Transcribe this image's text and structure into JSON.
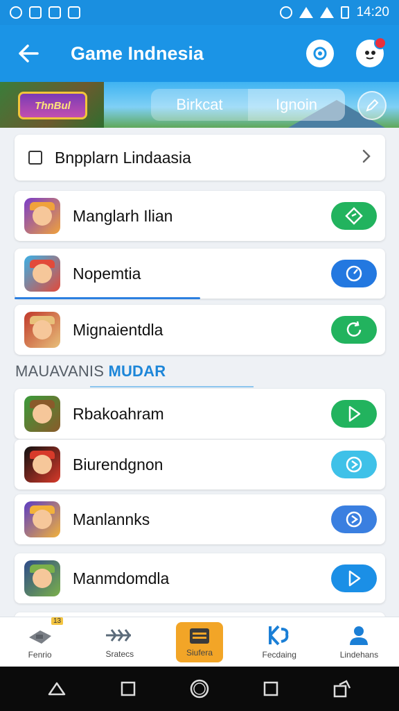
{
  "status_bar": {
    "time": "14:20"
  },
  "app_bar": {
    "title": "Game Indnesia"
  },
  "banner": {
    "logo_text": "ThnBul",
    "tabs": [
      {
        "label": "Birkcat",
        "active": false
      },
      {
        "label": "Ignoin",
        "active": true
      }
    ]
  },
  "select_row": {
    "label": "Bnpplarn Lindaasia"
  },
  "games_top": [
    {
      "name": "Manglarh Ilian",
      "button_color": "#22b35e",
      "icon_colors": [
        "#7a3cc9",
        "#f0a23b"
      ]
    },
    {
      "name": "Nopemtia",
      "button_color": "#2378e0",
      "icon_colors": [
        "#3bb0e6",
        "#e24a3a"
      ],
      "progress": 0.5
    },
    {
      "name": "Mignaientdla",
      "button_color": "#22b35e",
      "icon_colors": [
        "#c0392b",
        "#e8c07a"
      ]
    }
  ],
  "section": {
    "label_plain": "MAUAVANIS",
    "label_accent": "MUDAR"
  },
  "games_bottom": [
    {
      "name": "Rbakoahram",
      "button_color": "#22b35e",
      "icon_colors": [
        "#3a9b3a",
        "#8a5a2a"
      ]
    },
    {
      "name": "Biurendgnon",
      "button_color": "#3fc1e8",
      "icon_colors": [
        "#111111",
        "#d83a2a"
      ]
    },
    {
      "name": "Manlannks",
      "button_color": "#3a7fe0",
      "icon_colors": [
        "#5b3cc4",
        "#f2b23b"
      ]
    },
    {
      "name": "Manmdomdla",
      "button_color": "#1b8fe6",
      "icon_colors": [
        "#2d4a8a",
        "#7bb04a"
      ]
    }
  ],
  "bottom_nav": [
    {
      "label": "Fenrio",
      "icon": "gamepad-icon",
      "active": false,
      "badge": "13"
    },
    {
      "label": "Sratecs",
      "icon": "fish-icon",
      "active": false
    },
    {
      "label": "Siufera",
      "icon": "list-icon",
      "active": true
    },
    {
      "label": "Fecdaing",
      "icon": "k-logo-icon",
      "active": false
    },
    {
      "label": "Lindehans",
      "icon": "profile-icon",
      "active": false
    }
  ]
}
